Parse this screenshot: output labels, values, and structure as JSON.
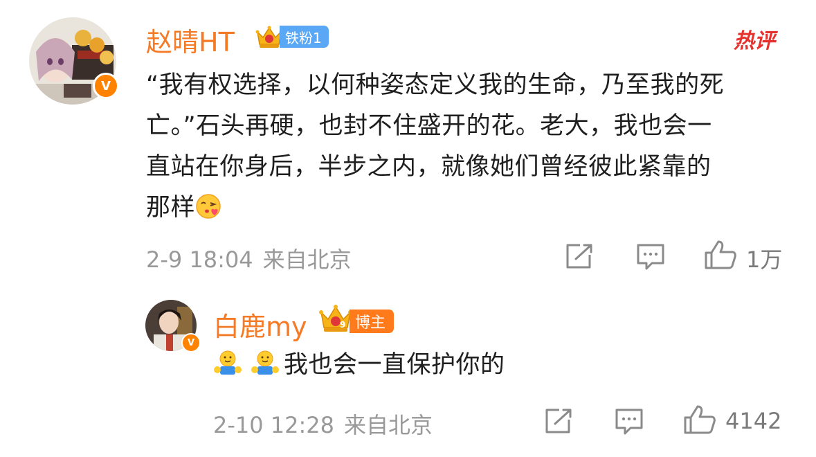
{
  "comment": {
    "username": "赵晴HT",
    "badge_label": "铁粉1",
    "hot_label": "热评",
    "text_lines": [
      "“我有权选择，以何种姿态定义我的生命，乃至我的死",
      "亡。”石头再硬，也封不住盛开的花。老大，我也会一",
      "直站在你身后，半步之内，就像她们曾经彼此紧靠的",
      "那样"
    ],
    "emoji": "blowing-kiss-emoji",
    "date": "2-9 18:04",
    "location": "来自北京",
    "likes": "1万",
    "verified_mark": "V"
  },
  "reply": {
    "username": "白鹿my",
    "crown_level": "9",
    "badge_label": "博主",
    "emoji": "hug-emoji",
    "text": "我也会一直保护你的",
    "date": "2-10 12:28",
    "location": "来自北京",
    "likes": "4142",
    "verified_mark": "V"
  },
  "colors": {
    "username": "#f57a26",
    "badge_fan": "#5aa8f5",
    "badge_blogger": "#ff7a1a",
    "hot": "#e5322e",
    "meta": "#999999",
    "verified": "#ff8200"
  }
}
